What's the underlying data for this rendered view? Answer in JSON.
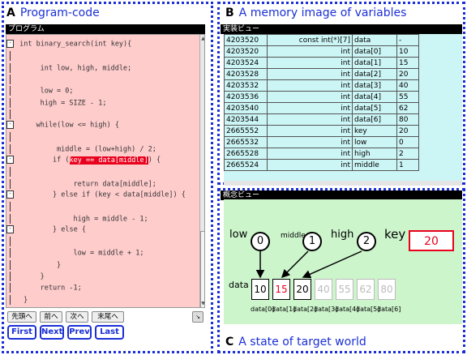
{
  "panels": {
    "a": {
      "letter": "A",
      "title": "Program-code"
    },
    "b": {
      "letter": "B",
      "title": "A memory image of variables"
    },
    "c": {
      "letter": "C",
      "title": "A state of target world"
    }
  },
  "program_view": {
    "header": "プログラム",
    "lines": [
      {
        "fold": "-",
        "text": " int binary_search(int key){"
      },
      {
        "fold": "",
        "text": ""
      },
      {
        "fold": "",
        "text": "     int low, high, middle;"
      },
      {
        "fold": "",
        "text": ""
      },
      {
        "fold": "",
        "text": "     low = 0;"
      },
      {
        "fold": "",
        "text": "     high = SIZE - 1;"
      },
      {
        "fold": "",
        "text": ""
      },
      {
        "fold": "-",
        "text": "     while(low <= high) {"
      },
      {
        "fold": "",
        "text": ""
      },
      {
        "fold": "",
        "text": "         middle = (low+high) / 2;"
      },
      {
        "fold": "-",
        "text": "         if (",
        "highlight": "key == data[middle]",
        "after": ") {"
      },
      {
        "fold": "",
        "text": ""
      },
      {
        "fold": "",
        "text": "             return data[middle];"
      },
      {
        "fold": "-",
        "text": "         } else if (key < data[middle]) {"
      },
      {
        "fold": "",
        "text": ""
      },
      {
        "fold": "",
        "text": "             high = middle - 1;"
      },
      {
        "fold": "-",
        "text": "         } else {"
      },
      {
        "fold": "",
        "text": ""
      },
      {
        "fold": "",
        "text": "             low = middle + 1;"
      },
      {
        "fold": "",
        "text": "         }"
      },
      {
        "fold": "",
        "text": "     }"
      },
      {
        "fold": "",
        "text": "     return -1;"
      },
      {
        "fold": "",
        "text": " }"
      }
    ],
    "jump_buttons": [
      "先頭へ",
      "前へ",
      "次へ",
      "末尾へ"
    ],
    "nav_buttons": [
      "First",
      "Next",
      "Prev",
      "Last"
    ]
  },
  "memory_view": {
    "header": "実装ビュー",
    "rows": [
      [
        "4203520",
        "const int(*)[7]",
        "data",
        "-"
      ],
      [
        "4203520",
        "int",
        "data[0]",
        "10"
      ],
      [
        "4203524",
        "int",
        "data[1]",
        "15"
      ],
      [
        "4203528",
        "int",
        "data[2]",
        "20"
      ],
      [
        "4203532",
        "int",
        "data[3]",
        "40"
      ],
      [
        "4203536",
        "int",
        "data[4]",
        "55"
      ],
      [
        "4203540",
        "int",
        "data[5]",
        "62"
      ],
      [
        "4203544",
        "int",
        "data[6]",
        "80"
      ],
      [
        "2665552",
        "int",
        "key",
        "20"
      ],
      [
        "2665532",
        "int",
        "low",
        "0"
      ],
      [
        "2665528",
        "int",
        "high",
        "2"
      ],
      [
        "2665524",
        "int",
        "middle",
        "1"
      ]
    ]
  },
  "concept_view": {
    "header": "概念ビュー",
    "low": {
      "label": "low",
      "value": "0"
    },
    "middle": {
      "label": "middle",
      "value": "1"
    },
    "high": {
      "label": "high",
      "value": "2"
    },
    "key": {
      "label": "key",
      "value": "20"
    },
    "array_label": "data",
    "array": [
      {
        "value": "10",
        "index": "data[0]",
        "state": "active"
      },
      {
        "value": "15",
        "index": "data[1]",
        "state": "middle"
      },
      {
        "value": "20",
        "index": "data[2]",
        "state": "active"
      },
      {
        "value": "40",
        "index": "data[3]",
        "state": "dim"
      },
      {
        "value": "55",
        "index": "data[4]",
        "state": "dim"
      },
      {
        "value": "62",
        "index": "data[5]",
        "state": "dim"
      },
      {
        "value": "80",
        "index": "data[6]",
        "state": "dim"
      }
    ]
  },
  "colors": {
    "accent": "#1a2fd6",
    "code_bg": "#ffcccc",
    "memory_bg": "#ccf5f5",
    "world_bg": "#ccf5cc",
    "highlight": "#e8001c"
  }
}
